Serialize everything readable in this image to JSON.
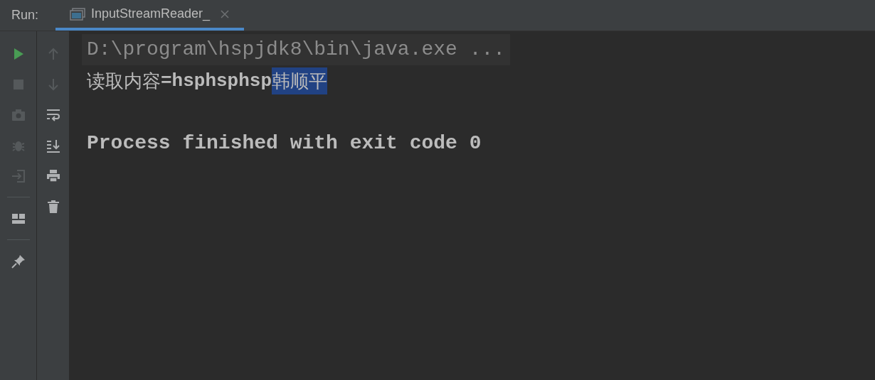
{
  "run_label": "Run:",
  "tabs": [
    {
      "label": "InputStreamReader_",
      "selected": true
    }
  ],
  "left_toolbar": [
    {
      "kind": "run",
      "disabled": false
    },
    {
      "kind": "stop",
      "disabled": true
    },
    {
      "kind": "camera",
      "disabled": true
    },
    {
      "kind": "bug",
      "disabled": true
    },
    {
      "kind": "enter",
      "disabled": true
    },
    {
      "kind": "separator"
    },
    {
      "kind": "layout",
      "disabled": false
    },
    {
      "kind": "separator"
    },
    {
      "kind": "pin",
      "disabled": false
    }
  ],
  "right_toolbar": [
    {
      "kind": "up",
      "disabled": true
    },
    {
      "kind": "down",
      "disabled": true
    },
    {
      "kind": "wrap",
      "disabled": false
    },
    {
      "kind": "scroll-end",
      "disabled": false
    },
    {
      "kind": "print",
      "disabled": false
    },
    {
      "kind": "trash",
      "disabled": false
    }
  ],
  "console": [
    {
      "kind": "command",
      "text": "D:\\program\\hspjdk8\\bin\\java.exe ..."
    },
    {
      "kind": "output",
      "segments": [
        {
          "text": "读取内容",
          "kind": "cjk",
          "selected": false
        },
        {
          "text": "=hsphsphsp",
          "kind": "latin",
          "selected": false
        },
        {
          "text": "韩顺平",
          "kind": "cjk",
          "selected": true
        }
      ]
    },
    {
      "kind": "blank"
    },
    {
      "kind": "status",
      "text": "Process finished with exit code 0"
    }
  ]
}
